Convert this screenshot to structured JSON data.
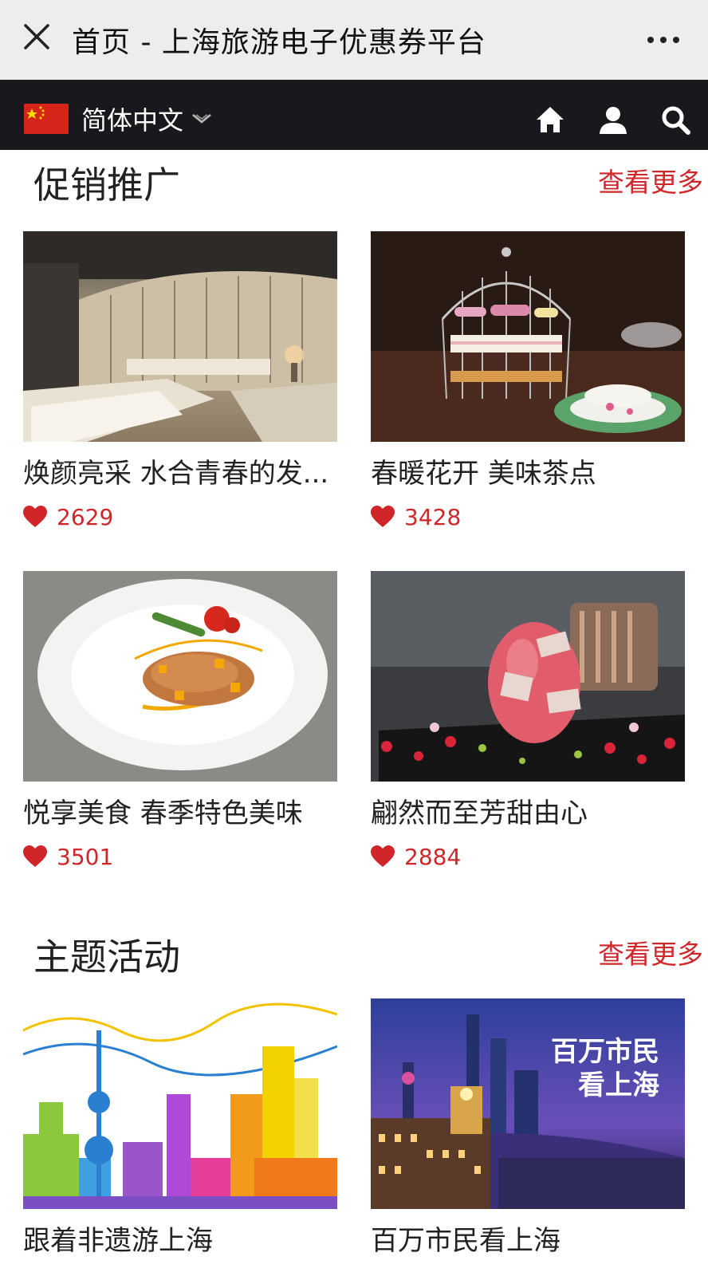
{
  "titlebar": {
    "title": "首页 - 上海旅游电子优惠券平台",
    "close_icon": "close-icon",
    "more_icon": "more-icon"
  },
  "navbar": {
    "language": "简体中文",
    "flag_icon": "china-flag-icon",
    "icons": [
      "home-icon",
      "user-icon",
      "search-icon"
    ]
  },
  "promotions": {
    "title": "促销推广",
    "more": "查看更多",
    "items": [
      {
        "name": "焕颜亮采 水合青春的发...",
        "likes": "2629"
      },
      {
        "name": "春暖花开 美味茶点",
        "likes": "3428"
      },
      {
        "name": "悦享美食 春季特色美味",
        "likes": "3501"
      },
      {
        "name": "翩然而至芳甜由心",
        "likes": "2884"
      }
    ]
  },
  "themes": {
    "title": "主题活动",
    "more": "查看更多",
    "items": [
      {
        "name": "跟着非遗游上海"
      },
      {
        "name": "百万市民看上海",
        "image_text_line1": "百万市民",
        "image_text_line2": "看上海"
      }
    ]
  },
  "colors": {
    "accent": "#d0262a",
    "nav_bg": "#19191d",
    "titlebar_bg": "#ededed"
  }
}
